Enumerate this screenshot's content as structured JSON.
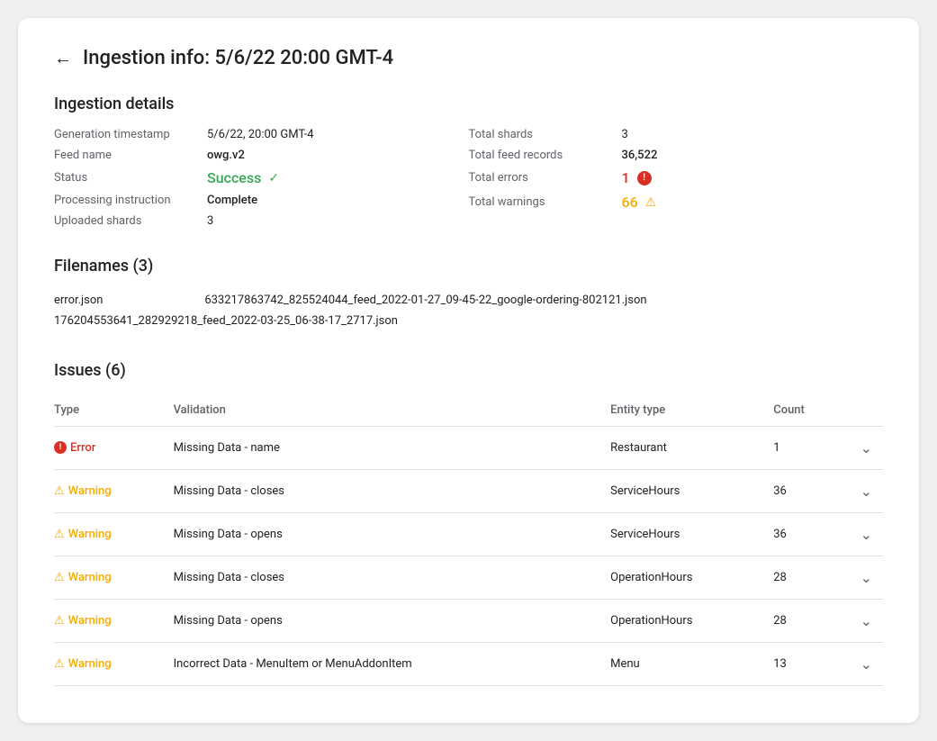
{
  "header": {
    "back_label": "←",
    "title": "Ingestion info: 5/6/22 20:00 GMT-4"
  },
  "ingestion_details": {
    "section_title": "Ingestion details",
    "left": {
      "generation_timestamp_label": "Generation timestamp",
      "generation_timestamp_value": "5/6/22, 20:00 GMT-4",
      "feed_name_label": "Feed name",
      "feed_name_value": "owg.v2",
      "status_label": "Status",
      "status_value": "Success",
      "processing_instruction_label": "Processing instruction",
      "processing_instruction_value": "Complete",
      "uploaded_shards_label": "Uploaded shards",
      "uploaded_shards_value": "3"
    },
    "right": {
      "total_shards_label": "Total shards",
      "total_shards_value": "3",
      "total_feed_records_label": "Total feed records",
      "total_feed_records_value": "36,522",
      "total_errors_label": "Total errors",
      "total_errors_value": "1",
      "total_warnings_label": "Total warnings",
      "total_warnings_value": "66"
    }
  },
  "filenames": {
    "section_title": "Filenames (3)",
    "files": [
      "error.json",
      "633217863742_825524044_feed_2022-01-27_09-45-22_google-ordering-802121.json",
      "176204553641_282929218_feed_2022-03-25_06-38-17_2717.json"
    ]
  },
  "issues": {
    "section_title": "Issues (6)",
    "columns": {
      "type": "Type",
      "validation": "Validation",
      "entity_type": "Entity type",
      "count": "Count"
    },
    "rows": [
      {
        "type": "Error",
        "type_kind": "error",
        "validation": "Missing Data - name",
        "entity_type": "Restaurant",
        "count": "1"
      },
      {
        "type": "Warning",
        "type_kind": "warning",
        "validation": "Missing Data - closes",
        "entity_type": "ServiceHours",
        "count": "36"
      },
      {
        "type": "Warning",
        "type_kind": "warning",
        "validation": "Missing Data - opens",
        "entity_type": "ServiceHours",
        "count": "36"
      },
      {
        "type": "Warning",
        "type_kind": "warning",
        "validation": "Missing Data - closes",
        "entity_type": "OperationHours",
        "count": "28"
      },
      {
        "type": "Warning",
        "type_kind": "warning",
        "validation": "Missing Data - opens",
        "entity_type": "OperationHours",
        "count": "28"
      },
      {
        "type": "Warning",
        "type_kind": "warning",
        "validation": "Incorrect Data - MenuItem or MenuAddonItem",
        "entity_type": "Menu",
        "count": "13"
      }
    ]
  },
  "icons": {
    "back": "←",
    "check": "✓",
    "chevron_down": "∨",
    "error_badge": "●",
    "warning_badge": "▲"
  }
}
